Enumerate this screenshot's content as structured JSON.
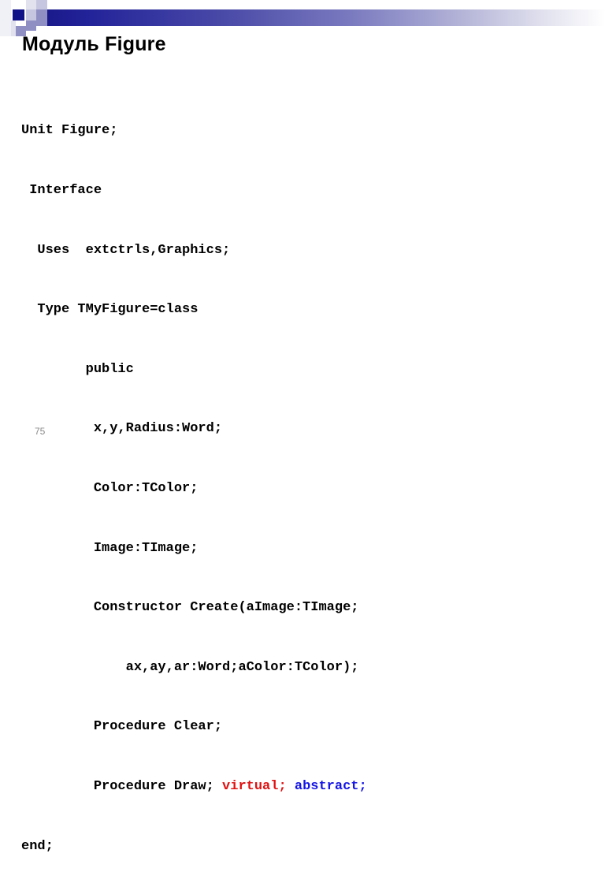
{
  "slide": {
    "title": "Модуль Figure",
    "page_number": "75"
  },
  "decoration": {
    "bar_gradient_start": "#1a1a8c",
    "bar_gradient_end": "#ffffff",
    "square_dark": "#111188",
    "square_mid": "#8f8fc4",
    "square_light": "#c6c6e0",
    "square_pale": "#e2e2ef"
  },
  "code": {
    "language": "pascal",
    "keyword_virtual_color": "#e01010",
    "keyword_abstract_color": "#1414e6",
    "lines": [
      {
        "text": "Unit Figure;"
      },
      {
        "text": " Interface"
      },
      {
        "text": "  Uses  extctrls,Graphics;"
      },
      {
        "text": "  Type TMyFigure=class"
      },
      {
        "text": "        public"
      },
      {
        "text": "         x,y,Radius:Word;"
      },
      {
        "text": "         Color:TColor;"
      },
      {
        "text": "         Image:TImage;"
      },
      {
        "text": "         Constructor Create(aImage:TImage;"
      },
      {
        "text": "             ax,ay,ar:Word;aColor:TColor);"
      },
      {
        "text": "         Procedure Clear;"
      },
      {
        "prefix": "         Procedure Draw; ",
        "red": "virtual;",
        "middle": " ",
        "blue": "abstract;"
      },
      {
        "text": "end;"
      }
    ]
  }
}
